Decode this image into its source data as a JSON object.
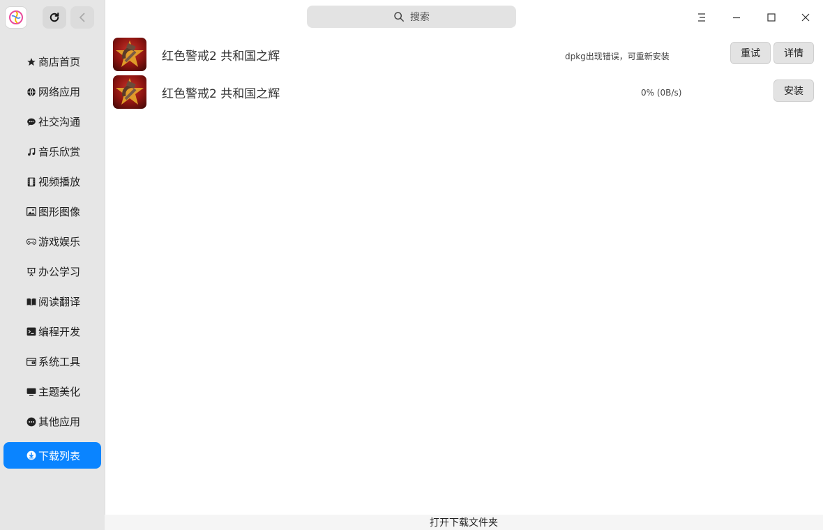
{
  "search": {
    "placeholder": "搜索"
  },
  "sidebar": {
    "items": [
      {
        "label": "商店首页",
        "icon": "star-icon"
      },
      {
        "label": "网络应用",
        "icon": "globe-icon"
      },
      {
        "label": "社交沟通",
        "icon": "chat-icon"
      },
      {
        "label": "音乐欣赏",
        "icon": "music-note-icon"
      },
      {
        "label": "视频播放",
        "icon": "film-icon"
      },
      {
        "label": "图形图像",
        "icon": "image-icon"
      },
      {
        "label": "游戏娱乐",
        "icon": "gamepad-icon"
      },
      {
        "label": "办公学习",
        "icon": "presentation-icon"
      },
      {
        "label": "阅读翻译",
        "icon": "book-icon"
      },
      {
        "label": "编程开发",
        "icon": "terminal-icon"
      },
      {
        "label": "系统工具",
        "icon": "wallet-icon"
      },
      {
        "label": "主题美化",
        "icon": "monitor-icon"
      },
      {
        "label": "其他应用",
        "icon": "more-icon"
      }
    ],
    "active": {
      "label": "下载列表",
      "icon": "download-icon"
    }
  },
  "downloads": [
    {
      "title": "红色警戒2 共和国之辉",
      "status": "dpkg出现错误，可重新安装",
      "buttons": [
        "重试",
        "详情"
      ]
    },
    {
      "title": "红色警戒2 共和国之辉",
      "status": "0% (0B/s)",
      "buttons": [
        "安装"
      ]
    }
  ],
  "footer": {
    "label": "打开下载文件夹"
  },
  "colors": {
    "accent": "#0a84ff",
    "sidebar_bg": "#e6e6e6"
  }
}
